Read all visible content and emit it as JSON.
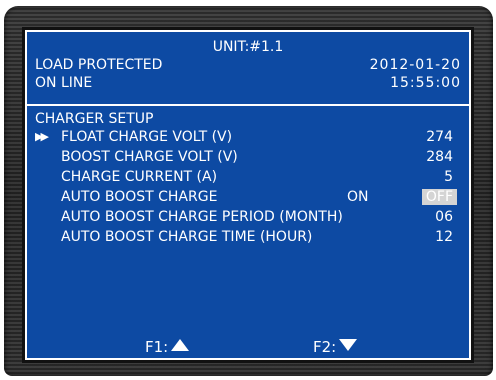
{
  "header": {
    "unit": "UNIT:#1.1",
    "status_line1": "LOAD PROTECTED",
    "status_line2": "ON LINE",
    "date": "2012-01-20",
    "time": "15:55:00"
  },
  "section": {
    "title": "CHARGER SETUP",
    "cursor_icon": "double-right-triangle",
    "rows": [
      {
        "label": "FLOAT CHARGE VOLT (V)",
        "value": "274",
        "selected": true
      },
      {
        "label": "BOOST CHARGE VOLT (V)",
        "value": "284"
      },
      {
        "label": "CHARGE CURRENT (A)",
        "value": "5"
      },
      {
        "label": "AUTO BOOST CHARGE",
        "option_on": "ON",
        "option_off": "OFF",
        "value": "OFF"
      },
      {
        "label": "AUTO BOOST CHARGE PERIOD (MONTH)",
        "value": "06"
      },
      {
        "label": "AUTO BOOST CHARGE TIME (HOUR)",
        "value": "12"
      }
    ]
  },
  "footer": {
    "f1_label": "F1:",
    "f1_icon": "up-triangle",
    "f2_label": "F2:",
    "f2_icon": "down-triangle"
  },
  "colors": {
    "screen_bg": "#0d4aa3",
    "text": "#ffffff",
    "highlight_bg": "#d4d4d4",
    "bezel": "#2e2e2e"
  }
}
